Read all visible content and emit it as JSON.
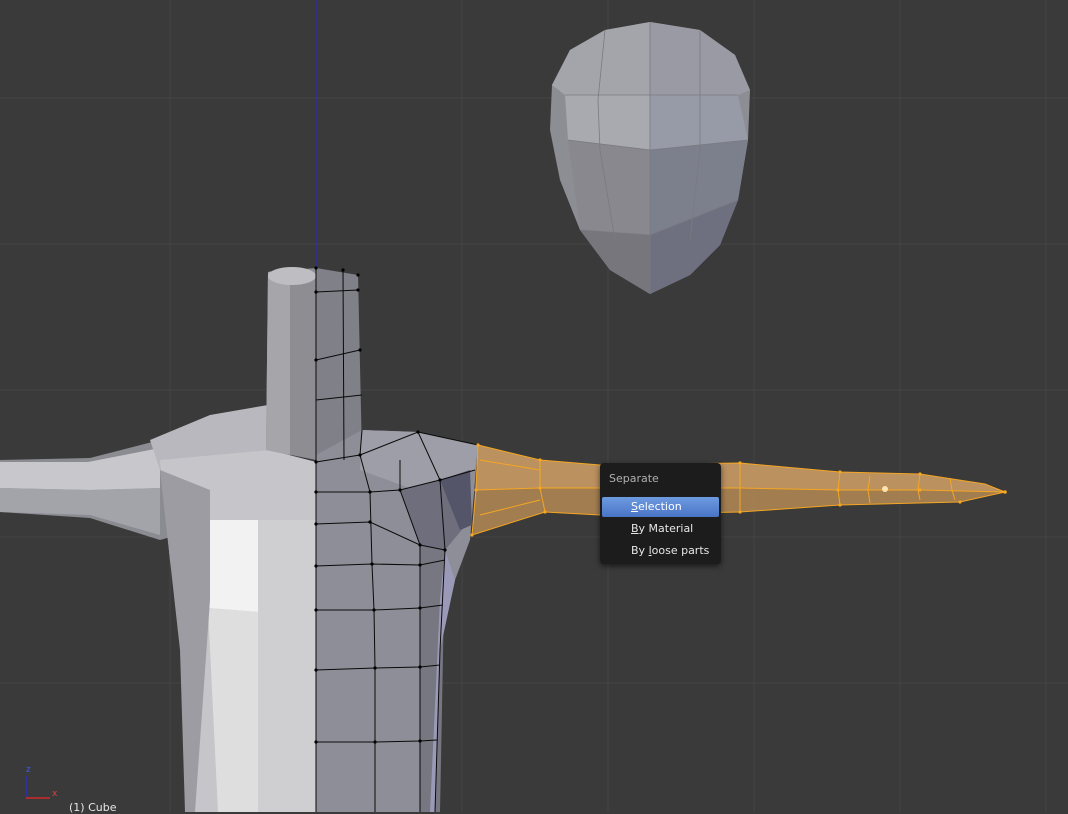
{
  "viewport": {
    "object_label": "(1) Cube",
    "axes": {
      "x": "x",
      "z": "z"
    }
  },
  "separate_menu": {
    "title": "Separate",
    "items": [
      {
        "id": "selection",
        "pre": "",
        "key": "S",
        "post": "election",
        "active": true
      },
      {
        "id": "by_material",
        "pre": "",
        "key": "B",
        "post": "y Material",
        "active": false
      },
      {
        "id": "by_loose_parts",
        "pre": "By ",
        "key": "l",
        "post": "oose parts",
        "active": false
      }
    ]
  },
  "colors": {
    "background": "#3a3a3a",
    "grid": "#444444",
    "selection_orange": "#f5a623",
    "menu_bg": "#1c1c1c",
    "menu_highlight": "#5680c2",
    "z_axis": "#2b2bd0"
  }
}
